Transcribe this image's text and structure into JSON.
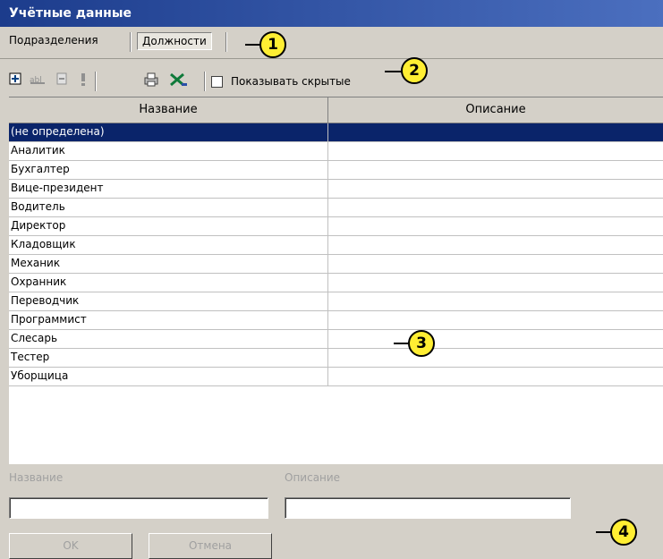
{
  "window": {
    "title": "Учётные данные"
  },
  "tabs": [
    {
      "label": "Подразделения",
      "active": false
    },
    {
      "label": "Должности",
      "active": true
    }
  ],
  "toolbar": {
    "icons": [
      "add-icon",
      "edit-icon",
      "delete-icon",
      "info-icon",
      "print-icon",
      "excel-icon"
    ],
    "show_hidden_label": "Показывать скрытые",
    "show_hidden_checked": false
  },
  "grid": {
    "columns": [
      "Название",
      "Описание"
    ],
    "rows": [
      {
        "name": "(не определена)",
        "description": "",
        "selected": true
      },
      {
        "name": "Аналитик",
        "description": ""
      },
      {
        "name": "Бухгалтер",
        "description": ""
      },
      {
        "name": "Вице-президент",
        "description": ""
      },
      {
        "name": "Водитель",
        "description": ""
      },
      {
        "name": "Директор",
        "description": ""
      },
      {
        "name": "Кладовщик",
        "description": ""
      },
      {
        "name": "Механик",
        "description": ""
      },
      {
        "name": "Охранник",
        "description": ""
      },
      {
        "name": "Переводчик",
        "description": ""
      },
      {
        "name": "Программист",
        "description": ""
      },
      {
        "name": "Слесарь",
        "description": ""
      },
      {
        "name": "Тестер",
        "description": ""
      },
      {
        "name": "Уборщица",
        "description": ""
      }
    ]
  },
  "form": {
    "name_label": "Название",
    "description_label": "Описание",
    "name_value": "",
    "description_value": "",
    "ok_label": "OK",
    "cancel_label": "Отмена"
  },
  "callouts": [
    "1",
    "2",
    "3",
    "4"
  ],
  "colors": {
    "selection": "#0a246a",
    "callout": "#ffee33",
    "titlebar": "#1c3c8c"
  }
}
